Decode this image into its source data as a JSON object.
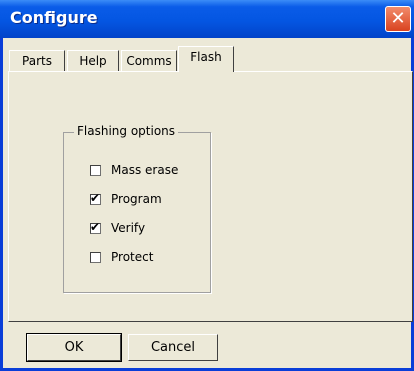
{
  "window": {
    "title": "Configure",
    "close_glyph": "✕"
  },
  "tabs": [
    {
      "label": "Parts"
    },
    {
      "label": "Help"
    },
    {
      "label": "Comms"
    },
    {
      "label": "Flash",
      "active": true
    }
  ],
  "group": {
    "title": "Flashing options",
    "options": [
      {
        "label": "Mass erase",
        "checked": false
      },
      {
        "label": "Program",
        "checked": true
      },
      {
        "label": "Verify",
        "checked": true
      },
      {
        "label": "Protect",
        "checked": false
      }
    ]
  },
  "buttons": {
    "ok": "OK",
    "cancel": "Cancel"
  },
  "icons": {
    "check": "✔"
  }
}
